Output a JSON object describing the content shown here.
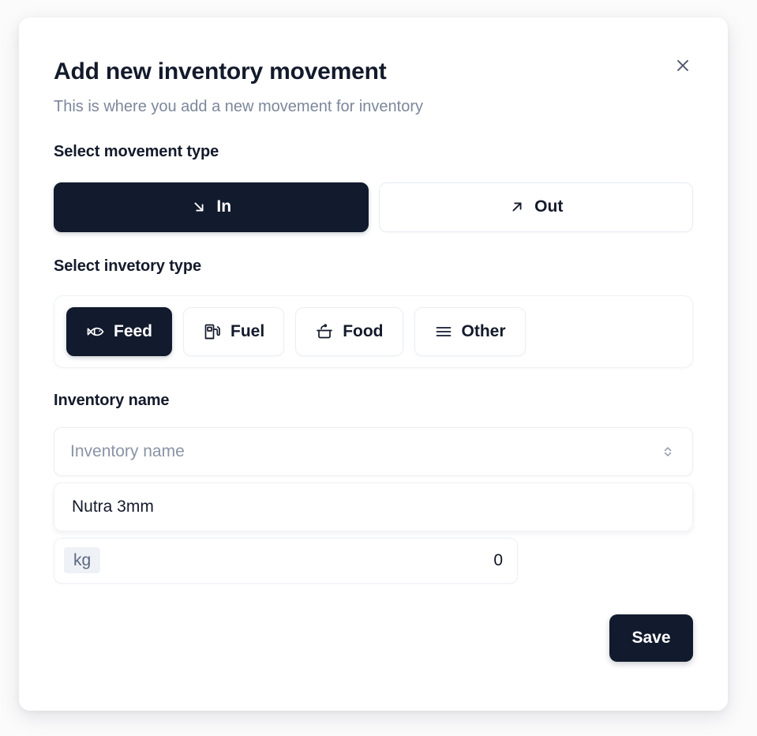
{
  "modal": {
    "title": "Add new inventory movement",
    "subtitle": "This is where you add a new movement for inventory",
    "close_label": "×"
  },
  "movement_section": {
    "label": "Select movement type",
    "options": [
      {
        "label": "In",
        "icon": "arrow-down-right-icon",
        "selected": true
      },
      {
        "label": "Out",
        "icon": "arrow-up-right-icon",
        "selected": false
      }
    ]
  },
  "inventory_type_section": {
    "label": "Select invetory type",
    "options": [
      {
        "label": "Feed",
        "icon": "fish-icon",
        "selected": true
      },
      {
        "label": "Fuel",
        "icon": "gas-pump-icon",
        "selected": false
      },
      {
        "label": "Food",
        "icon": "cooking-pot-icon",
        "selected": false
      },
      {
        "label": "Other",
        "icon": "list-icon",
        "selected": false
      }
    ]
  },
  "inventory_name_section": {
    "label": "Inventory name",
    "select_placeholder": "Inventory name",
    "option_value": "Nutra 3mm"
  },
  "quantity_field": {
    "unit": "kg",
    "value": "0"
  },
  "footer": {
    "save_label": "Save"
  },
  "colors": {
    "accent_dark": "#121a2d",
    "page_background": "#fbfbfc",
    "card_background": "#ffffff",
    "muted_text": "#7c879b",
    "border": "#eaeef4"
  }
}
